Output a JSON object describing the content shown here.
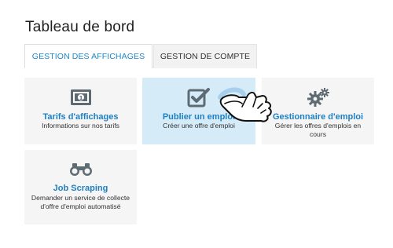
{
  "page": {
    "title": "Tableau de bord"
  },
  "tabs": [
    {
      "label": "GESTION DES AFFICHAGES",
      "active": true
    },
    {
      "label": "GESTION DE COMPTE",
      "active": false
    }
  ],
  "cards": [
    {
      "icon": "money-icon",
      "title": "Tarifs d'affichages",
      "description": "Informations sur nos tarifs"
    },
    {
      "icon": "checkbox-icon",
      "title": "Publier un emploi",
      "description": "Créer une offre d'emploi",
      "highlighted": true
    },
    {
      "icon": "gears-icon",
      "title": "Gestionnaire d'emploi",
      "description": "Gérer les offres d'emplois en cours"
    },
    {
      "icon": "binoculars-icon",
      "title": "Job Scraping",
      "description": "Demander un service de collecte d'offre d'emploi automatisé"
    }
  ],
  "colors": {
    "accent": "#1e7fc2",
    "icon": "#5f6b73",
    "highlight": "#d5ecf8",
    "card_bg": "#f5f5f5"
  }
}
